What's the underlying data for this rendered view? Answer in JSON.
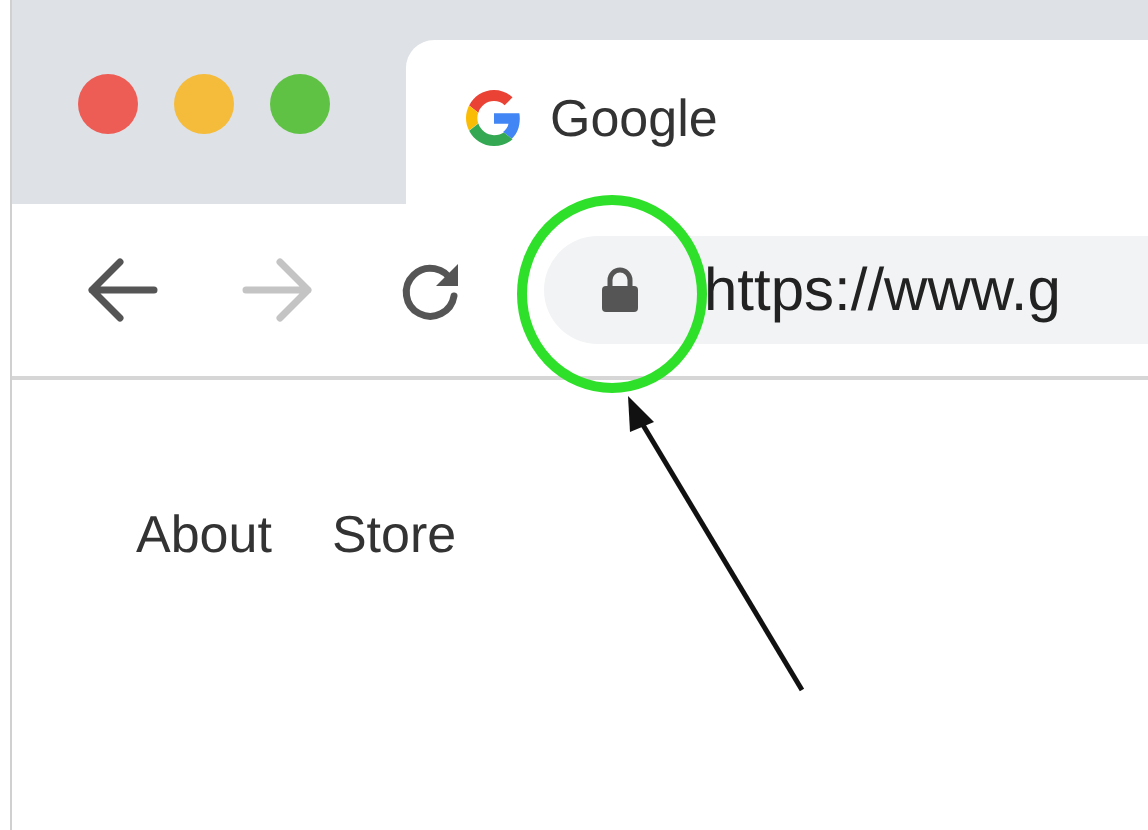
{
  "tab": {
    "title": "Google"
  },
  "address_bar": {
    "url": "https://www.g"
  },
  "toolbar": {
    "forward_disabled": true
  },
  "page_links": [
    "About",
    "Store"
  ]
}
